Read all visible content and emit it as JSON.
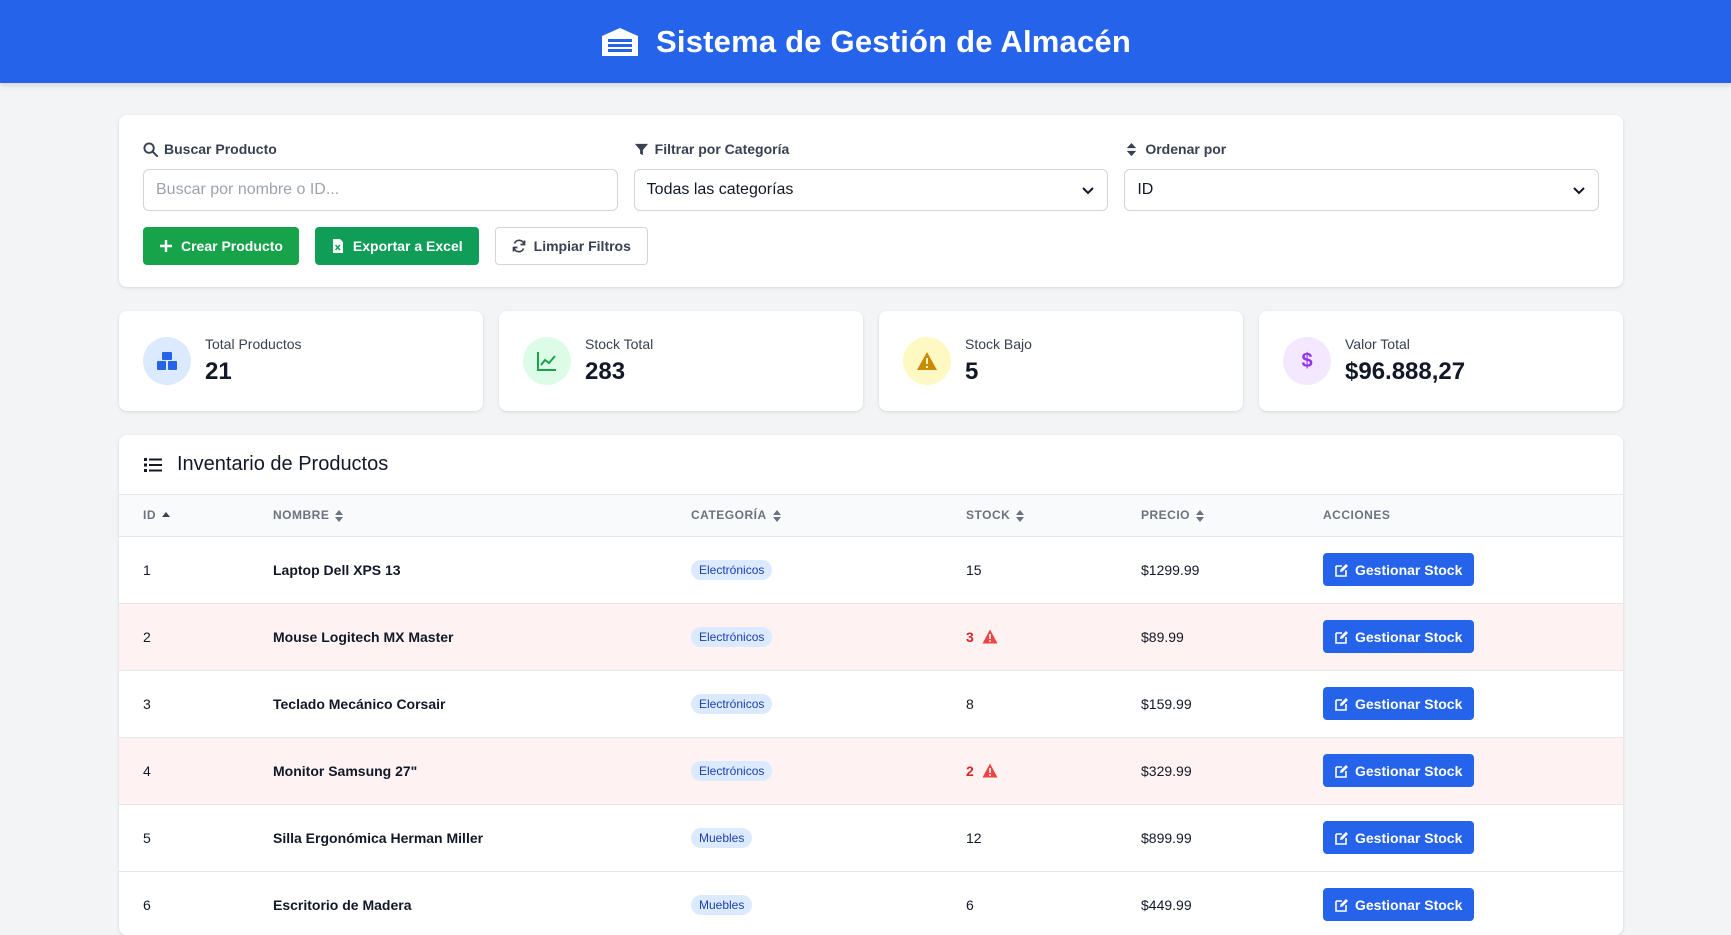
{
  "header": {
    "title": "Sistema de Gestión de Almacén",
    "logo_icon": "warehouse-icon"
  },
  "filters": {
    "search": {
      "label": "Buscar Producto",
      "placeholder": "Buscar por nombre o ID...",
      "value": ""
    },
    "category": {
      "label": "Filtrar por Categoría",
      "selected": "Todas las categorías"
    },
    "sort": {
      "label": "Ordenar por",
      "selected": "ID"
    },
    "buttons": {
      "create": "Crear Producto",
      "export": "Exportar a Excel",
      "clear": "Limpiar Filtros"
    }
  },
  "stats": [
    {
      "label": "Total Productos",
      "value": "21",
      "icon": "boxes-icon",
      "color": "#2563eb",
      "bg": "#dbeafe"
    },
    {
      "label": "Stock Total",
      "value": "283",
      "icon": "chart-line-icon",
      "color": "#16a34a",
      "bg": "#dcfce7"
    },
    {
      "label": "Stock Bajo",
      "value": "5",
      "icon": "warning-icon",
      "color": "#ca8a04",
      "bg": "#fef9c3"
    },
    {
      "label": "Valor Total",
      "value": "$96.888,27",
      "icon": "dollar-icon",
      "color": "#9333ea",
      "bg": "#f3e8ff"
    }
  ],
  "table": {
    "title": "Inventario de Productos",
    "columns": [
      "ID",
      "Nombre",
      "Categoría",
      "Stock",
      "Precio",
      "Acciones"
    ],
    "action_label": "Gestionar Stock",
    "rows": [
      {
        "id": "1",
        "name": "Laptop Dell XPS 13",
        "category": "Electrónicos",
        "stock": "15",
        "price": "$1299.99",
        "low": false
      },
      {
        "id": "2",
        "name": "Mouse Logitech MX Master",
        "category": "Electrónicos",
        "stock": "3",
        "price": "$89.99",
        "low": true
      },
      {
        "id": "3",
        "name": "Teclado Mecánico Corsair",
        "category": "Electrónicos",
        "stock": "8",
        "price": "$159.99",
        "low": false
      },
      {
        "id": "4",
        "name": "Monitor Samsung 27\"",
        "category": "Electrónicos",
        "stock": "2",
        "price": "$329.99",
        "low": true
      },
      {
        "id": "5",
        "name": "Silla Ergonómica Herman Miller",
        "category": "Muebles",
        "stock": "12",
        "price": "$899.99",
        "low": false
      },
      {
        "id": "6",
        "name": "Escritorio de Madera",
        "category": "Muebles",
        "stock": "6",
        "price": "$449.99",
        "low": false
      }
    ]
  },
  "colors": {
    "primary": "#2563eb",
    "success": "#16a34a",
    "danger": "#dc2626"
  }
}
